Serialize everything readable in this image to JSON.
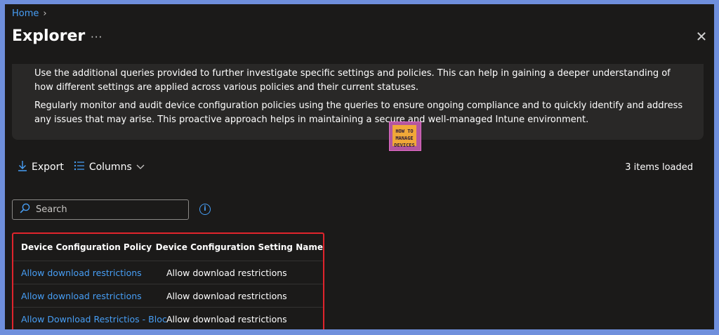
{
  "breadcrumb": {
    "home": "Home",
    "separator": "›"
  },
  "header": {
    "title": "Explorer",
    "more": "···",
    "close": "✕"
  },
  "info": {
    "paragraph1": "Use the additional queries provided to further investigate specific settings and policies. This can help in gaining a deeper understanding of how different settings are applied across various policies and their current statuses.",
    "paragraph2": "Regularly monitor and audit device configuration policies using the queries to ensure ongoing compliance and to quickly identify and address any issues that may arise. This proactive approach helps in maintaining a secure and well-managed Intune environment."
  },
  "logo": {
    "line1": "HOW TO",
    "line2": "MANAGE",
    "line3": "DEVICES"
  },
  "toolbar": {
    "export_label": "Export",
    "export_icon": "download-icon",
    "columns_label": "Columns",
    "columns_icon": "list-icon",
    "items_loaded": "3 items loaded"
  },
  "search": {
    "placeholder": "Search"
  },
  "table": {
    "headers": [
      "Device Configuration Policy",
      "Device Configuration Setting Name"
    ],
    "rows": [
      {
        "policy": "Allow download restrictions",
        "setting": "Allow download restrictions"
      },
      {
        "policy": "Allow download restrictions",
        "setting": "Allow download restrictions"
      },
      {
        "policy": "Allow Download Restrictios - Block",
        "setting": "Allow download restrictions"
      }
    ]
  },
  "colors": {
    "accent": "#479ef5",
    "highlight_border": "#e0242c",
    "background": "#1b1a19"
  }
}
